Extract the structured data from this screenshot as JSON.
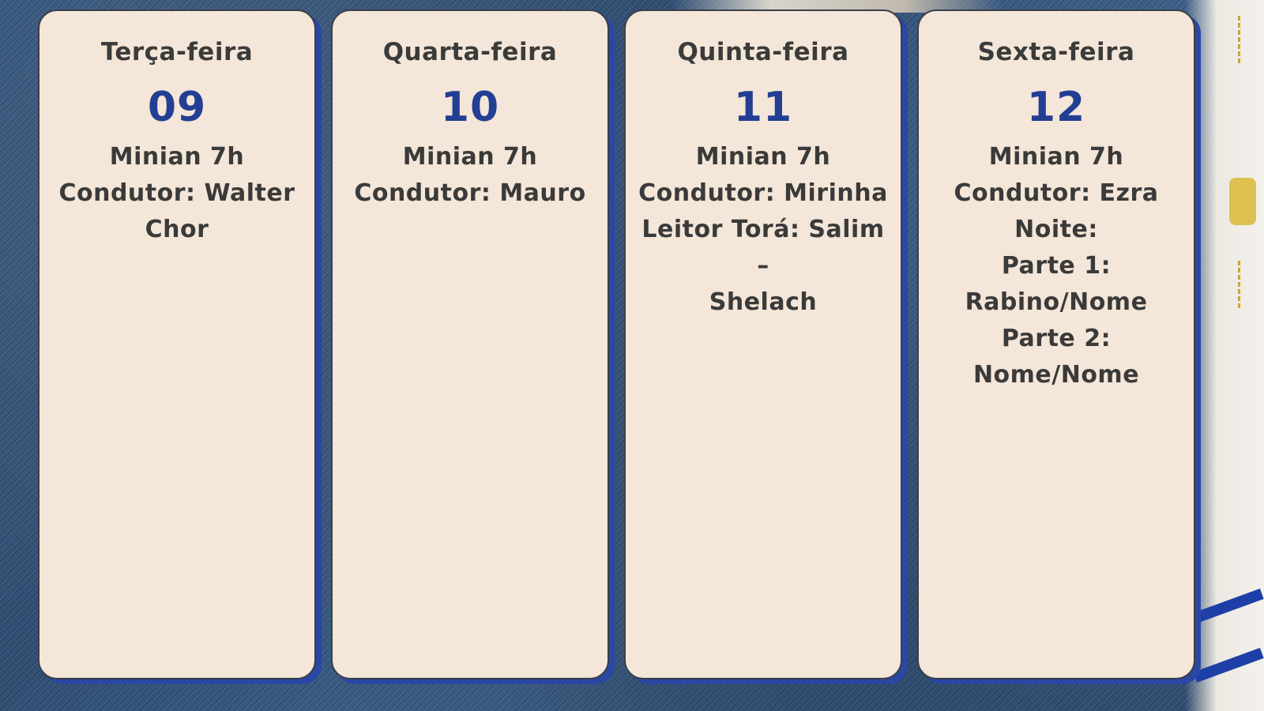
{
  "days": [
    {
      "name": "Terça-feira",
      "number": "09",
      "lines": [
        "Minian 7h",
        "Condutor: Walter",
        "Chor"
      ]
    },
    {
      "name": "Quarta-feira",
      "number": "10",
      "lines": [
        "Minian 7h",
        "Condutor: Mauro"
      ]
    },
    {
      "name": "Quinta-feira",
      "number": "11",
      "lines": [
        "Minian 7h",
        "Condutor: Mirinha",
        "Leitor Torá: Salim –",
        "Shelach"
      ]
    },
    {
      "name": "Sexta-feira",
      "number": "12",
      "lines": [
        "Minian 7h",
        "Condutor: Ezra",
        "Noite:",
        "Parte 1:",
        "Rabino/Nome",
        "Parte 2:",
        "Nome/Nome"
      ]
    }
  ],
  "colors": {
    "card_background": "#f4e6d8",
    "day_number": "#233f94",
    "card_shadow": "#2a47a3",
    "background": "#34557b"
  }
}
